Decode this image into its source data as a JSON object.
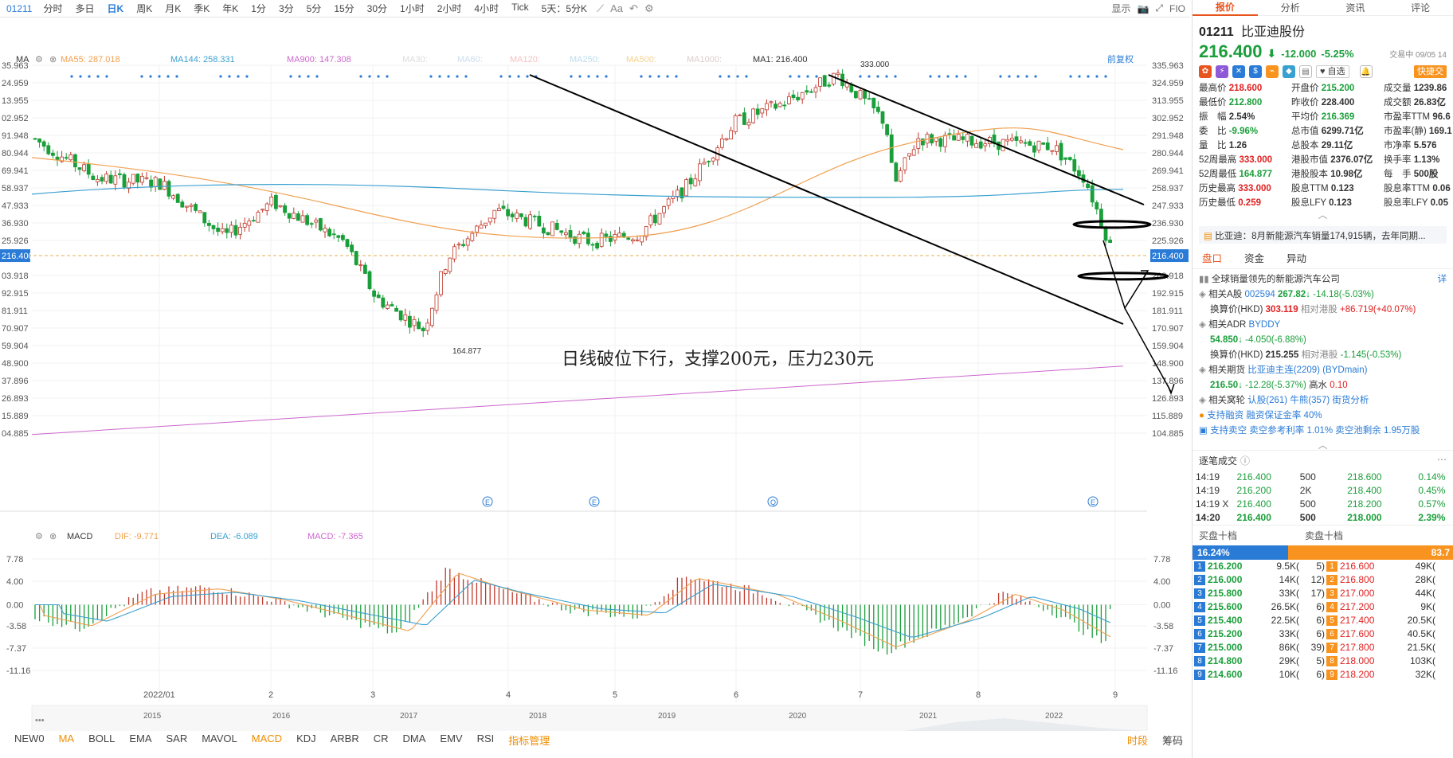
{
  "topbar": {
    "code": "01211",
    "periods": [
      "分时",
      "多日",
      "日K",
      "周K",
      "月K",
      "季K",
      "年K",
      "1分",
      "3分",
      "5分",
      "15分",
      "30分",
      "1小时",
      "2小时",
      "4小时",
      "Tick",
      "5天：5分K"
    ],
    "active_period": "日K",
    "right_items": [
      "显示",
      "FIO"
    ]
  },
  "chart": {
    "ma_label": "MA",
    "ma55": "MA55: 287.018",
    "ma144": "MA144: 258.331",
    "ma900": "MA900: 147.308",
    "ma30": "MA30:",
    "ma60": "MA60:",
    "ma120": "MA120:",
    "ma250": "MA250:",
    "ma500": "MA500:",
    "ma1000": "MA1000:",
    "ma1": "MA1: 216.400",
    "adjust": "前复权",
    "price_labels": [
      "335.963",
      "324.959",
      "313.955",
      "302.952",
      "291.948",
      "280.944",
      "269.941",
      "258.937",
      "247.933",
      "236.930",
      "225.926",
      "216.400",
      "203.918",
      "192.915",
      "181.911",
      "170.907",
      "159.904",
      "148.900",
      "137.896",
      "126.893",
      "115.889",
      "104.885"
    ],
    "high_label": "333.000",
    "low_label": "164.877",
    "annotation": "日线破位下行，支撑200元，压力230元",
    "event_marks": [
      "E",
      "E",
      "Q",
      "E"
    ],
    "macd_label": "MACD",
    "dif": "DIF: -9.771",
    "dea": "DEA: -6.089",
    "macd": "MACD: -7.365",
    "macd_labels": [
      "7.78",
      "4.00",
      "0.00",
      "-3.58",
      "-7.37",
      "-11.16"
    ],
    "x_labels": [
      "2022/01",
      "2",
      "3",
      "4",
      "5",
      "6",
      "7",
      "8",
      "9"
    ],
    "year_labels": [
      "2015",
      "2016",
      "2017",
      "2018",
      "2019",
      "2020",
      "2021",
      "2022"
    ],
    "colors": {
      "up": "#c0392b",
      "down": "#1a9e3a",
      "ma55": "#f0a050",
      "ma144": "#3aa0d0",
      "ma900": "#cc66cc",
      "dif": "#f0a050",
      "dea": "#3aa0d0"
    }
  },
  "indicators": [
    "NEW0",
    "MA",
    "BOLL",
    "EMA",
    "SAR",
    "MAVOL",
    "MACD",
    "KDJ",
    "ARBR",
    "CR",
    "DMA",
    "EMV",
    "RSI",
    "指标管理"
  ],
  "indicators_active": [
    "MA",
    "MACD"
  ],
  "bottom_right": [
    "时段",
    "筹码"
  ],
  "panel": {
    "tabs": [
      "报价",
      "分析",
      "资讯",
      "评论"
    ],
    "code": "01211",
    "name": "比亚迪股份",
    "price": "216.400",
    "change": "-12.000",
    "change_pct": "-5.25%",
    "status": "交易中 09/05 14",
    "watch": "自选",
    "fast_trade": "快捷交",
    "quotes": [
      [
        "最高价",
        "218.600",
        "开盘价",
        "215.200",
        "成交量",
        "1239.86"
      ],
      [
        "最低价",
        "212.800",
        "昨收价",
        "228.400",
        "成交额",
        "26.83亿"
      ],
      [
        "振　幅",
        "2.54%",
        "平均价",
        "216.369",
        "市盈率TTM",
        "96.6"
      ],
      [
        "委　比",
        "-9.96%",
        "总市值",
        "6299.71亿",
        "市盈率(静)",
        "169.1"
      ],
      [
        "量　比",
        "1.26",
        "总股本",
        "29.11亿",
        "市净率",
        "5.576"
      ],
      [
        "52周最高",
        "333.000",
        "港股市值",
        "2376.07亿",
        "换手率",
        "1.13%"
      ],
      [
        "52周最低",
        "164.877",
        "港股股本",
        "10.98亿",
        "每　手",
        "500股"
      ],
      [
        "历史最高",
        "333.000",
        "股息TTM",
        "0.123",
        "股息率TTM",
        "0.06"
      ],
      [
        "历史最低",
        "0.259",
        "股息LFY",
        "0.123",
        "股息率LFY",
        "0.05"
      ]
    ],
    "news": "比亚迪：8月新能源汽车销量174,915辆，去年同期...",
    "subtabs": [
      "盘口",
      "资金",
      "异动"
    ],
    "company": "全球销量领先的新能源汽车公司",
    "detail": "详",
    "related": {
      "a_label": "相关A股",
      "a_code": "002594",
      "a_price": "267.82",
      "a_chg": "-14.18(-5.03%)",
      "conv_label": "换算价(HKD)",
      "conv": "303.119",
      "rel_label": "相对港股",
      "rel": "+86.719(+40.07%)",
      "adr_label": "相关ADR",
      "adr_code": "BYDDY",
      "adr_price": "54.850",
      "adr_chg": "-4.050(-6.88%)",
      "adr_conv": "215.255",
      "adr_rel": "-1.145(-0.53%)",
      "fut_label": "相关期货",
      "fut_name": "比亚迪主连(2209)",
      "fut_code": "(BYDmain)",
      "fut_price": "216.50",
      "fut_chg": "-12.28(-5.37%)",
      "fut_prem_label": "高水",
      "fut_prem": "0.10",
      "war_label": "相关窝轮",
      "war_buy": "认股(261)",
      "war_bull": "牛熊(357)",
      "war_street": "街货分析",
      "margin": "支持融资",
      "margin_rate": "融资保证金率 40%",
      "short": "支持卖空",
      "short_ref": "卖空参考利率 1.01%",
      "short_pool": "卖空池剩余 1.95万股"
    },
    "ticks_title": "逐笔成交",
    "ticks": [
      [
        "14:19",
        "216.400",
        "500",
        "218.600",
        "0.14%"
      ],
      [
        "14:19",
        "216.200",
        "2K",
        "218.400",
        "0.45%"
      ],
      [
        "14:19 X",
        "216.400",
        "500",
        "218.200",
        "0.57%"
      ],
      [
        "14:20",
        "216.400",
        "500",
        "218.000",
        "2.39%"
      ]
    ],
    "bid_title": "买盘十档",
    "ask_title": "卖盘十档",
    "bid_ratio": "16.24%",
    "ask_ratio": "83.7",
    "book": [
      [
        "1",
        "216.200",
        "9.5K(",
        "5)",
        "1",
        "216.600",
        "49K("
      ],
      [
        "2",
        "216.000",
        "14K(",
        "12)",
        "2",
        "216.800",
        "28K("
      ],
      [
        "3",
        "215.800",
        "33K(",
        "17)",
        "3",
        "217.000",
        "44K("
      ],
      [
        "4",
        "215.600",
        "26.5K(",
        "6)",
        "4",
        "217.200",
        "9K("
      ],
      [
        "5",
        "215.400",
        "22.5K(",
        "6)",
        "5",
        "217.400",
        "20.5K("
      ],
      [
        "6",
        "215.200",
        "33K(",
        "6)",
        "6",
        "217.600",
        "40.5K("
      ],
      [
        "7",
        "215.000",
        "86K(",
        "39)",
        "7",
        "217.800",
        "21.5K("
      ],
      [
        "8",
        "214.800",
        "29K(",
        "5)",
        "8",
        "218.000",
        "103K("
      ],
      [
        "9",
        "214.600",
        "10K(",
        "6)",
        "9",
        "218.200",
        "32K("
      ]
    ]
  }
}
